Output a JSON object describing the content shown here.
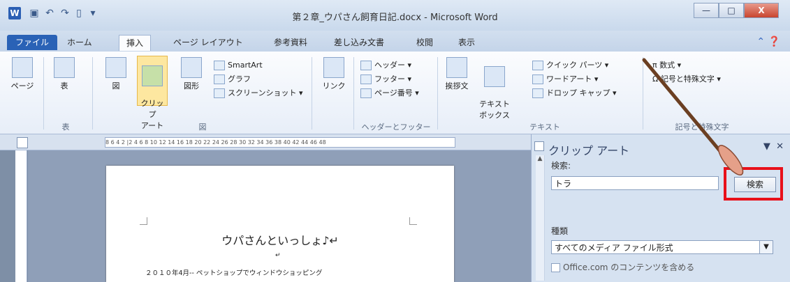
{
  "window": {
    "title": "第２章_ウパさん飼育日記.docx - Microsoft Word",
    "app_icon": "W",
    "qat": [
      "save-icon",
      "undo-icon",
      "redo-icon",
      "new-doc-icon",
      "customize-icon"
    ],
    "controls": {
      "minimize": "—",
      "maximize": "□",
      "close": "X"
    }
  },
  "tabs": [
    "ファイル",
    "ホーム",
    "挿入",
    "ページ レイアウト",
    "参考資料",
    "差し込み文書",
    "校閲",
    "表示"
  ],
  "ribbon": {
    "page": "ページ",
    "table": "表",
    "table_group": "表",
    "picture": "図",
    "clipart": "クリップ\nアート",
    "shapes": "図形",
    "smartart": "SmartArt",
    "chart": "グラフ",
    "screenshot": "スクリーンショット",
    "illus_group": "図",
    "link": "リンク",
    "header": "ヘッダー",
    "footer": "フッター",
    "page_number": "ページ番号",
    "hf_group": "ヘッダーとフッター",
    "greeting": "挨拶文",
    "textbox": "テキスト\nボックス",
    "quickparts": "クイック パーツ",
    "wordart": "ワードアート",
    "dropcap": "ドロップ キャップ",
    "text_group": "テキスト",
    "equation": "数式",
    "symbol": "記号と特殊文字",
    "symbol_group": "記号と特殊文字"
  },
  "ruler_text": "8 6 4 2 |2 4 6 8 10 12 14 16 18 20 22 24 26 28 30 32 34 36 38 40 42 44 46 48",
  "document": {
    "title": "ウパさんといっしょ♪↵",
    "mark": "↵",
    "line1": "２０１０年4月-- ペットショップでウィンドウショッピング"
  },
  "task_pane": {
    "title": "クリップ アート",
    "search_label": "検索:",
    "search_value": "トラ",
    "search_button": "検索",
    "type_label": "種類",
    "type_value": "すべてのメディア ファイル形式",
    "office_check": "Office.com のコンテンツを含める"
  },
  "colors": {
    "highlight": "#e8101a",
    "file_tab": "#2a62b6",
    "pointer": "#7a4a2a"
  }
}
